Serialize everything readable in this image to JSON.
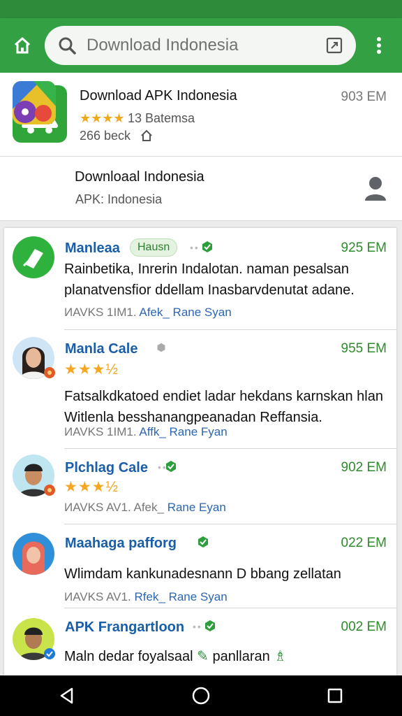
{
  "search": {
    "placeholder": "Download Indonesia"
  },
  "featured": [
    {
      "title": "Download APK Indonesia",
      "rating_text": "13 Batemsa",
      "stars": "★★★★",
      "meta": "266 beck",
      "size": "903 EM"
    },
    {
      "title": "Downloaal Indonesia",
      "subtitle": "APK: Indonesia"
    }
  ],
  "items": [
    {
      "name": "Manleaa",
      "tag": "Hausn",
      "size": "925 EM",
      "desc": "Rainbetika, Inrerin Indalotan. naman pesalsan planatvensfior ddellam Inasbarvdenutat adane.",
      "meta_plain": "ИAVKS 1IM1.",
      "meta_link": "Afek_ Rane Syan"
    },
    {
      "name": "Manla Cale",
      "size": "955 EM",
      "stars": "★★★½",
      "desc": "Fatsalkdkatoed endiet ladar hekdans karnskan hlan Witlenla besshanangpeanadan Reffansia.",
      "meta_plain": "ИAVKS 1IM1.",
      "meta_link": "Affk_ Rane Fyan"
    },
    {
      "name": "Plchlag Cale",
      "size": "902 EM",
      "stars": "★★★½",
      "meta_plain": "ИAVKS AV1. Afek_",
      "meta_link": "Rane Eyan"
    },
    {
      "name": "Maahaga pafforg",
      "size": "022 EM",
      "desc": "Wlimdam kankunadesnann D bbang zellatan",
      "meta_plain": "ИAVKS AV1.",
      "meta_link": "Rfek_ Rane Syan"
    },
    {
      "name": "APK Frangartloon",
      "size": "002 EM",
      "desc": "Maln dedar foyalsaal",
      "desc_tail": "panllaran"
    }
  ],
  "colors": {
    "app_bar": "#34a044",
    "status_bar": "#2e8b3a",
    "link": "#2b66b4",
    "size_green": "#2f8a2c",
    "star": "#f5a623"
  }
}
